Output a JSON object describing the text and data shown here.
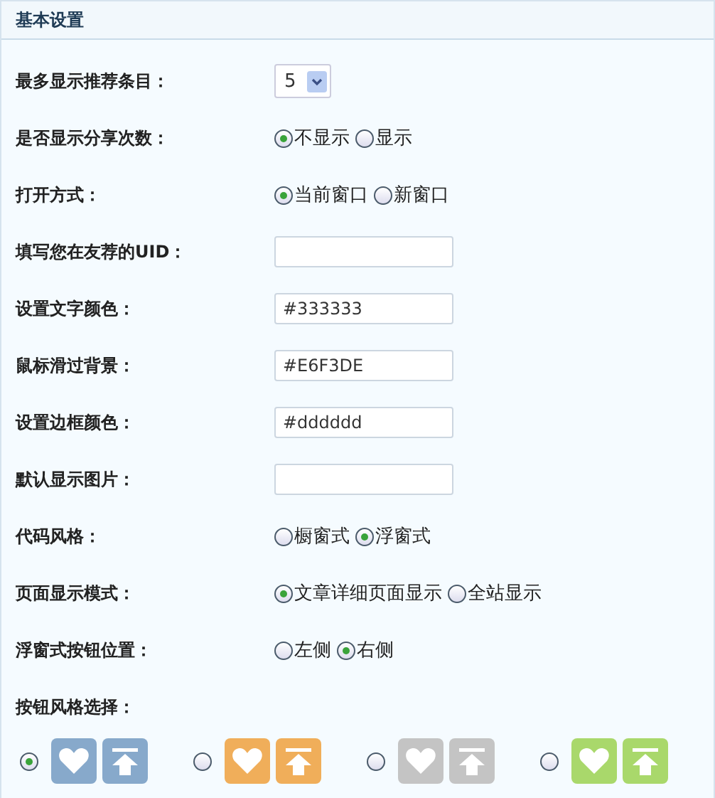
{
  "header": {
    "title": "基本设置"
  },
  "fields": [
    {
      "label": "最多显示推荐条目：",
      "kind": "select",
      "value": "5"
    },
    {
      "label": "是否显示分享次数：",
      "kind": "radio",
      "options": [
        {
          "label": "不显示",
          "selected": true
        },
        {
          "label": "显示",
          "selected": false
        }
      ]
    },
    {
      "label": "打开方式：",
      "kind": "radio",
      "options": [
        {
          "label": "当前窗口",
          "selected": true
        },
        {
          "label": "新窗口",
          "selected": false
        }
      ]
    },
    {
      "label": "填写您在友荐的UID：",
      "kind": "text"
    },
    {
      "label": "设置文字颜色：",
      "kind": "text",
      "value": "#333333"
    },
    {
      "label": "鼠标滑过背景：",
      "kind": "text",
      "value": "#E6F3DE"
    },
    {
      "label": "设置边框颜色：",
      "kind": "text",
      "value": "#dddddd"
    },
    {
      "label": "默认显示图片：",
      "kind": "text"
    },
    {
      "label": "代码风格：",
      "kind": "radio",
      "options": [
        {
          "label": "橱窗式",
          "selected": false
        },
        {
          "label": "浮窗式",
          "selected": true
        }
      ]
    },
    {
      "label": "页面显示模式：",
      "kind": "radio",
      "options": [
        {
          "label": "文章详细页面显示",
          "selected": true
        },
        {
          "label": "全站显示",
          "selected": false
        }
      ]
    },
    {
      "label": "浮窗式按钮位置：",
      "kind": "radio",
      "options": [
        {
          "label": "左侧",
          "selected": false
        },
        {
          "label": "右侧",
          "selected": true
        }
      ]
    }
  ],
  "button_style": {
    "label": "按钮风格选择：",
    "options": [
      {
        "color": "#87a9cb",
        "selected": true
      },
      {
        "color": "#f0ae5a",
        "selected": false
      },
      {
        "color": "#c4c4c4",
        "selected": false
      },
      {
        "color": "#a9d86b",
        "selected": false
      }
    ]
  }
}
